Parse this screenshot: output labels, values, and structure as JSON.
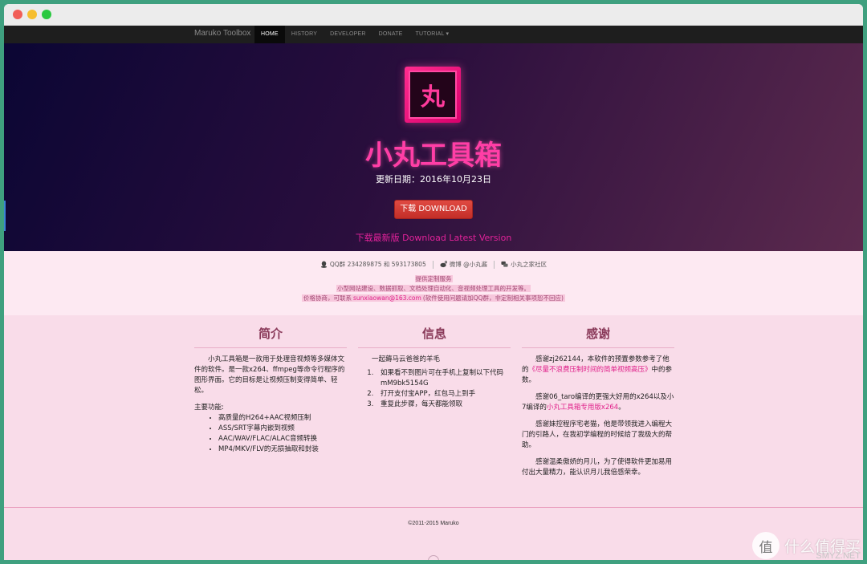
{
  "nav": {
    "brand": "Maruko Toolbox",
    "items": [
      {
        "label": "HOME"
      },
      {
        "label": "HISTORY"
      },
      {
        "label": "DEVELOPER"
      },
      {
        "label": "DONATE"
      },
      {
        "label": "TUTORIAL ▾"
      }
    ]
  },
  "hero": {
    "logo_char": "丸",
    "title": "小丸工具箱",
    "date": "更新日期：2016年10月23日",
    "download_label": "下载 DOWNLOAD",
    "latest_link": "下载最新版 Download Latest Version"
  },
  "contacts": {
    "qq": "QQ群 234289875 和 593173805",
    "weibo": "微博 @小丸酱",
    "community": "小丸之家社区"
  },
  "service": {
    "title": "提供定制服务",
    "line1": "小型网站建设、数据抓取、文档处理自动化、音视频处理工具的开发等。",
    "line2_prefix": "价格协商，可联系",
    "email": "sunxiaowan@163.com",
    "line2_suffix": "(软件使用问题请加QQ群，非定制相关事项恕不回应)"
  },
  "columns": {
    "intro": {
      "title": "简介",
      "desc": "小丸工具箱是一款用于处理音视频等多媒体文件的软件。是一款x264、ffmpeg等命令行程序的图形界面。它的目标是让视频压制变得简单、轻松。",
      "features_label": "主要功能:",
      "features": [
        "高质量的H264+AAC视频压制",
        "ASS/SRT字幕内嵌到视频",
        "AAC/WAV/FLAC/ALAC音频转换",
        "MP4/MKV/FLV的无损抽取和封装"
      ]
    },
    "info": {
      "title": "信息",
      "intro": "一起薅马云爸爸的羊毛",
      "steps": [
        "如果看不到图片可在手机上复制以下代码 mM9bk5154G",
        "打开支付宝APP，红包马上到手",
        "重复此步骤，每天都能领取"
      ]
    },
    "thanks": {
      "title": "感谢",
      "p1_a": "感谢zj262144，本软件的预置参数参考了他的",
      "p1_link": "《尽量不浪费压制时间的简单视频高压》",
      "p1_b": "中的参数。",
      "p2_a": "感谢06_taro编译的更强大好用的x264以及小7编译的",
      "p2_link": "小丸工具箱专用版x264",
      "p2_b": "。",
      "p3": "感谢妹控程序宅老猫，他是带领我进入编程大门的引路人，在我初学编程的时候给了我极大的帮助。",
      "p4": "感谢温柔傲娇的月儿，为了使得软件更加易用付出大量精力，能认识月儿我倍感荣幸。"
    }
  },
  "footer": {
    "copyright": "©2011-2015 Maruko"
  },
  "watermark": {
    "circle": "值",
    "text": "什么值得买",
    "sub": "SMYZ.NET"
  },
  "colors": {
    "accent_pink": "#e0218a",
    "navbar": "#1e1e1e",
    "download_button": "#d23a33",
    "page_background": "#f9dce9"
  }
}
